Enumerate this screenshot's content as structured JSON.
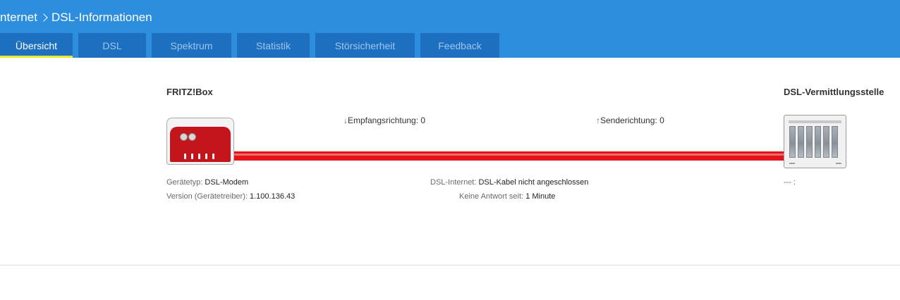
{
  "breadcrumb": {
    "parent": "nternet",
    "current": "DSL-Informationen"
  },
  "tabs": [
    {
      "label": "Übersicht",
      "active": true
    },
    {
      "label": "DSL",
      "active": false
    },
    {
      "label": "Spektrum",
      "active": false
    },
    {
      "label": "Statistik",
      "active": false
    },
    {
      "label": "Störsicherheit",
      "active": false
    },
    {
      "label": "Feedback",
      "active": false
    }
  ],
  "fritzbox": {
    "title": "FRITZ!Box",
    "device_type_label": "Gerätetyp:",
    "device_type_value": "DSL-Modem",
    "version_label": "Version (Gerätetreiber):",
    "version_value": "1.100.136.43"
  },
  "exchange": {
    "title": "DSL-Vermittlungsstelle",
    "info_text": "--- :"
  },
  "line": {
    "downstream_label": "Empfangsrichtung:",
    "downstream_value": "0",
    "upstream_label": "Senderichtung:",
    "upstream_value": "0",
    "dsl_internet_label": "DSL-Internet:",
    "dsl_internet_value": "DSL-Kabel nicht angeschlossen",
    "no_response_label": "Keine Antwort seit:",
    "no_response_value": "1 Minute"
  },
  "icons": {
    "breadcrumb_separator": "chevron-right-icon",
    "down_arrow": "↓",
    "up_arrow": "↑"
  },
  "colors": {
    "header_bg": "#2d8ee0",
    "tab_bg": "#1d6fc0",
    "tab_active_underline": "#e2ea2a",
    "cable": "#e4141a",
    "router_red": "#c5151c"
  }
}
